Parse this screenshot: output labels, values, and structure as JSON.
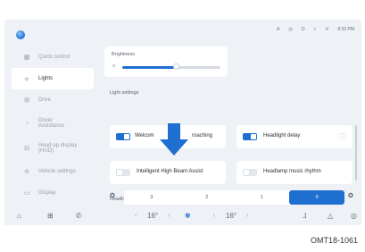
{
  "status": {
    "icons": [
      "a-icon",
      "target-icon",
      "circle-icon",
      "wifi-icon",
      "signal-icon"
    ],
    "glyphs": [
      "A",
      "◎",
      "O",
      "≈",
      "⨉"
    ],
    "time": "8:33 PM"
  },
  "sidebar": {
    "items": [
      {
        "label": "Quick control",
        "icon": "grid-icon",
        "glyph": "▦"
      },
      {
        "label": "Lights",
        "icon": "light-icon",
        "glyph": "☼",
        "active": true
      },
      {
        "label": "Drive",
        "icon": "drive-icon",
        "glyph": "⊞"
      },
      {
        "label": "Driver\nAssistance",
        "icon": "assist-icon",
        "glyph": "◔"
      },
      {
        "label": "Head-up display\n(HUD)",
        "icon": "hud-icon",
        "glyph": "⊟"
      },
      {
        "label": "Vehicle settings",
        "icon": "car-icon",
        "glyph": "⊖"
      },
      {
        "label": "Display",
        "icon": "display-icon",
        "glyph": "▭"
      }
    ]
  },
  "brightness": {
    "label": "Brightness",
    "level": 0.55
  },
  "light_settings": {
    "title": "Light settings",
    "welcome": {
      "label": "Welcom",
      "label_tail": "roaching",
      "on": true
    },
    "headlight_delay": {
      "label": "Headlight delay",
      "on": true
    },
    "ihba": {
      "label": "Intelligent High Beam Assist",
      "on": false
    },
    "headlamp_music": {
      "label": "Headlamp music rhythm",
      "on": false
    }
  },
  "height_adjust": {
    "title": "Headlight height adjustment",
    "segments": [
      "3",
      "2",
      "1",
      "0"
    ],
    "selected": "0"
  },
  "bottom_bar": {
    "temp_left": "16°",
    "temp_right": "16°",
    "left_arrow": "‹",
    "right_arrow": "›"
  },
  "caption": "OMT18-1061"
}
